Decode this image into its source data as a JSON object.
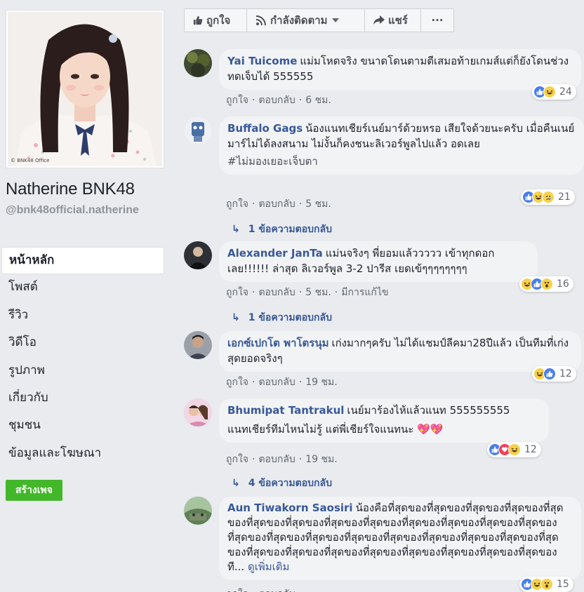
{
  "sidebar": {
    "photo_copyright": "© BNK48 Office",
    "page_name": "Natherine BNK48",
    "page_handle": "@bnk48official.natherine",
    "nav": [
      {
        "label": "หน้าหลัก"
      },
      {
        "label": "โพสต์"
      },
      {
        "label": "รีวิว"
      },
      {
        "label": "วิดีโอ"
      },
      {
        "label": "รูปภาพ"
      },
      {
        "label": "เกี่ยวกับ"
      },
      {
        "label": "ชุมชน"
      },
      {
        "label": "ข้อมูลและโฆษณา"
      }
    ],
    "create_page": "สร้างเพจ"
  },
  "action_bar": {
    "like": "ถูกใจ",
    "follow": "กำลังติดตาม",
    "share": "แชร์",
    "more": "···"
  },
  "labels": {
    "like": "ถูกใจ",
    "reply": "ตอบกลับ",
    "dot": "·"
  },
  "comments": [
    {
      "author": "Yai Tuicome",
      "text": "แม่มโหดจริง ขนาดโดนตามตีเสมอท้ายเกมส์แต่ก็ยังโดนช่วงทดเจ็บได้ 555555",
      "time": "6 ชม.",
      "reactions": [
        "like",
        "haha"
      ],
      "count": "24"
    },
    {
      "author": "Buffalo Gags",
      "text": "น้องแนทเชียร์เนย์มาร์ด้วยหรอ เสียใจด้วยนะครับ เมื่อคืนเนย์มาร์ไม่ได้ลงสนาม ไม่งั้นก็คงชนะลิเวอร์พูลไปแล้ว อดเลย",
      "hashtag": "#ไม่มองเยอะเจ็บตา",
      "time": "5 ชม.",
      "reactions": [
        "like",
        "haha",
        "sad"
      ],
      "count": "21",
      "replies": "1 ข้อความตอบกลับ"
    },
    {
      "author": "Alexander JanTa",
      "text": "แม่นจริงๆ พี่ยอมแล้ววววว เข้าทุกดอกเลย!!!!!! ล่าสุด ลิเวอร์พูล 3-2 ปารีส เยดเข้ๆๆๆๆๆๆๆๆ",
      "time": "5 ชม.",
      "edited": "มีการแก้ไข",
      "reactions": [
        "haha",
        "like",
        "wow"
      ],
      "count": "16",
      "replies": "1 ข้อความตอบกลับ"
    },
    {
      "author": "เอกซ์เปกโต พาโตรนุม",
      "text": "เก่งมากๆครับ ไม่ได้แชมป์ลีคมา28ปีแล้ว เป็นทีมที่เก่งสุดยอดจริงๆ",
      "time": "19 ชม.",
      "reactions": [
        "haha",
        "like"
      ],
      "count": "12"
    },
    {
      "author": "Bhumipat Tantrakul",
      "text": "เนย์มาร้องไห้แล้วแนท 555555555",
      "text2": "แนทเชียร์ทีมไหนไม่รู้ แต่พี่เชียร์ใจแนทนะ 💖💖",
      "time": "19 ชม.",
      "reactions": [
        "like",
        "love",
        "haha"
      ],
      "count": "12",
      "replies": "4 ข้อความตอบกลับ"
    },
    {
      "author": "Aun Tiwakorn Saosiri",
      "text": "น้องคือที่สุดของที่สุดของที่สุดของที่สุดของที่สุดของที่สุดของที่สุดของที่สุดของที่สุดของที่สุดของที่สุดของที่สุดของที่สุดของที่สุดของที่สุดของที่สุดของที่สุดของที่สุดของที่สุดของที่สุดของที่สุดของที่สุดของที่สุดของที่สุดของที่สุดของที่สุดของที่สุดของที่สุดของที่สุดของที่สุดของที...",
      "see_more": "ดูเพิ่มเติม",
      "time": "",
      "reactions": [
        "like",
        "haha",
        "wow"
      ],
      "count": "15"
    }
  ],
  "colors": {
    "background": "#e9ebee",
    "link": "#385898",
    "create_button": "#42b72a",
    "like_blue": "#4a7eec",
    "emoji_yellow": "#f7d14b",
    "love_red": "#f2415a"
  }
}
